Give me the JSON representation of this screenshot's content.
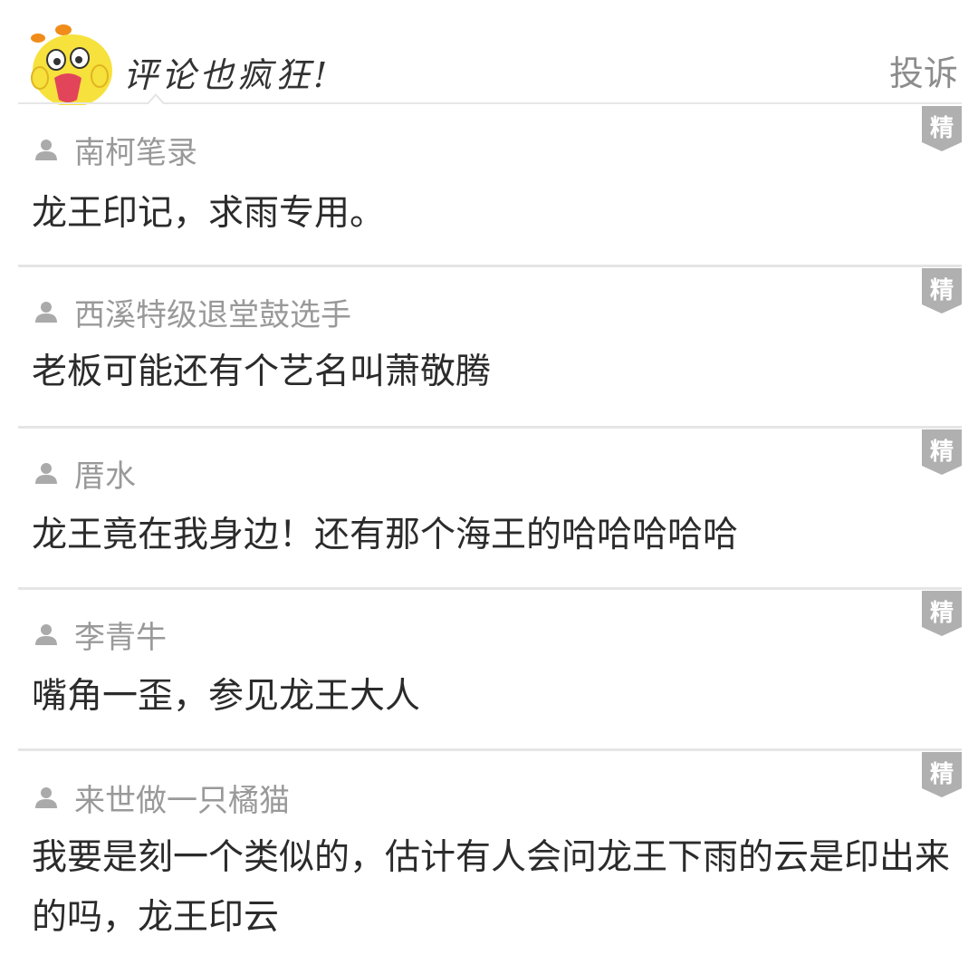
{
  "header": {
    "title": "评论也疯狂!",
    "report_label": "投诉",
    "mascot_icon": "yellow-chick-mascot"
  },
  "colors": {
    "separator": "#e5e5e5",
    "username": "#999999",
    "text": "#2b2b2b",
    "badge": "#b0b0b0",
    "mascot": "#f7e13c"
  },
  "comments": [
    {
      "username": "南柯笔录",
      "text": "龙王印记，求雨专用。",
      "badge": "精"
    },
    {
      "username": "西溪特级退堂鼓选手",
      "text": "老板可能还有个艺名叫萧敬腾",
      "badge": "精"
    },
    {
      "username": "厝水",
      "text": "龙王竟在我身边！还有那个海王的哈哈哈哈哈",
      "badge": "精"
    },
    {
      "username": "李青牛",
      "text": "嘴角一歪，参见龙王大人",
      "badge": "精"
    },
    {
      "username": "来世做一只橘猫",
      "text": "我要是刻一个类似的，估计有人会问龙王下雨的云是印出来的吗，龙王印云",
      "badge": "精"
    }
  ]
}
